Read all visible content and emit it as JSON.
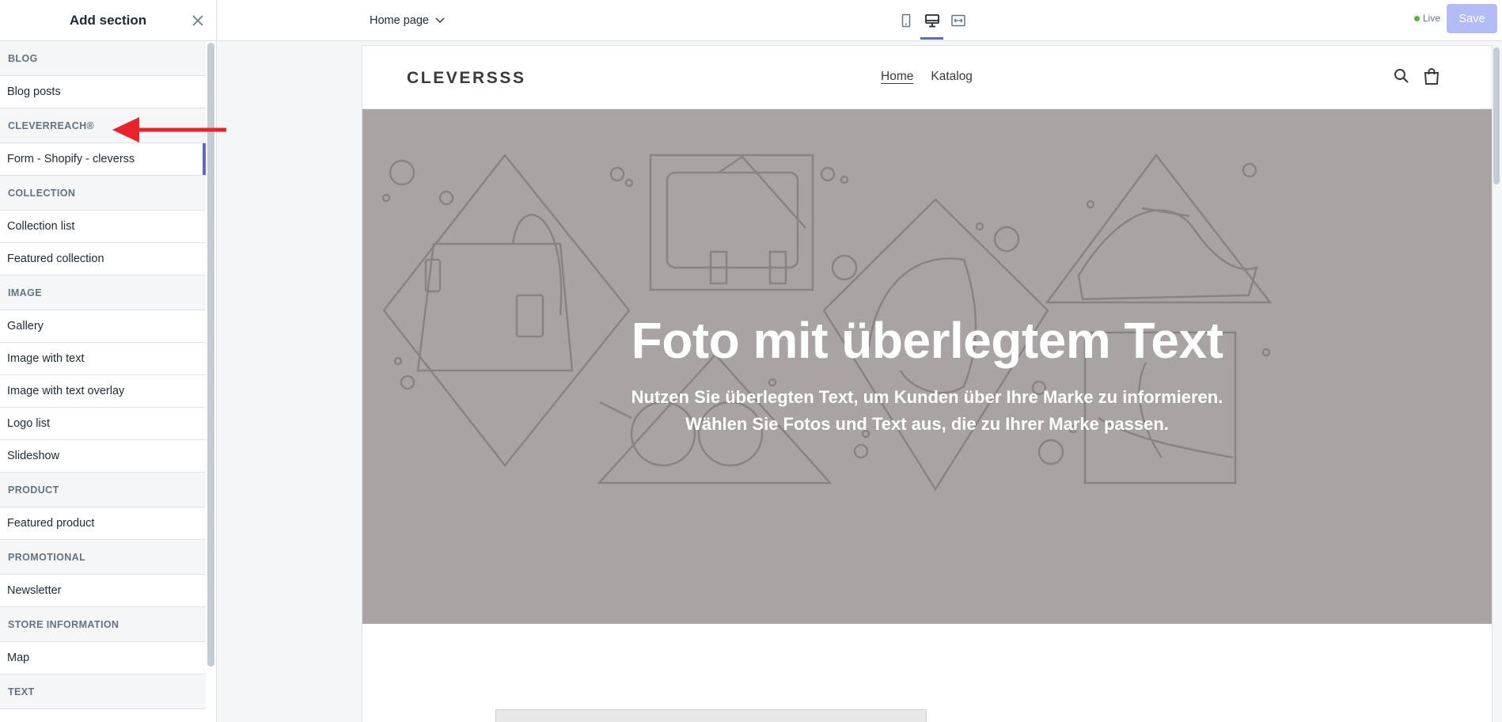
{
  "sidebar": {
    "title": "Add section",
    "groups": [
      {
        "label": "BLOG",
        "items": [
          {
            "label": "Blog posts"
          }
        ]
      },
      {
        "label": "CLEVERREACH®",
        "items": [
          {
            "label": "Form - Shopify - cleverss"
          }
        ]
      },
      {
        "label": "COLLECTION",
        "items": [
          {
            "label": "Collection list"
          },
          {
            "label": "Featured collection"
          }
        ]
      },
      {
        "label": "IMAGE",
        "items": [
          {
            "label": "Gallery"
          },
          {
            "label": "Image with text"
          },
          {
            "label": "Image with text overlay"
          },
          {
            "label": "Logo list"
          },
          {
            "label": "Slideshow"
          }
        ]
      },
      {
        "label": "PRODUCT",
        "items": [
          {
            "label": "Featured product"
          }
        ]
      },
      {
        "label": "PROMOTIONAL",
        "items": [
          {
            "label": "Newsletter"
          }
        ]
      },
      {
        "label": "STORE INFORMATION",
        "items": [
          {
            "label": "Map"
          }
        ]
      },
      {
        "label": "TEXT",
        "items": []
      }
    ]
  },
  "topbar": {
    "page_select": "Home page",
    "viewports": [
      "mobile-icon",
      "desktop-icon",
      "fullscreen-icon"
    ],
    "active_viewport": "desktop-icon",
    "live_label": "Live",
    "save_label": "Save"
  },
  "store": {
    "logo": "CLEVERSSS",
    "nav": [
      "Home",
      "Katalog"
    ],
    "hero_title": "Foto mit überlegtem Text",
    "hero_subtitle_1": "Nutzen Sie überlegten Text, um Kunden über Ihre Marke zu informieren.",
    "hero_subtitle_2": "Wählen Sie Fotos und Text aus, die zu Ihrer Marke passen."
  },
  "colors": {
    "accent": "#5c6ac4",
    "save_disabled": "#b3bcf5",
    "hero_bg": "#aaa3a3",
    "arrow": "#e8232a",
    "live": "#50b83c"
  }
}
